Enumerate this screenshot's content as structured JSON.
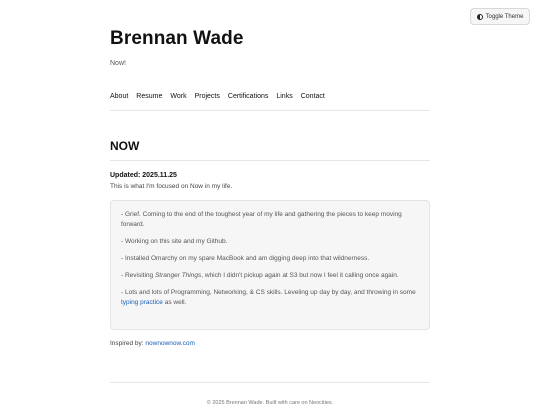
{
  "theme_toggle": {
    "label": "Toggle Theme",
    "icon": "half-moon-icon"
  },
  "header": {
    "name": "Brennan Wade",
    "tagline": "Now!"
  },
  "nav": [
    "About",
    "Resume",
    "Work",
    "Projects",
    "Certifications",
    "Links",
    "Contact"
  ],
  "now": {
    "title": "NOW",
    "updated": "Updated: 2025.11.25",
    "intro": "This is what I'm focused on Now in my life.",
    "items": [
      {
        "text": "- Grief. Coming to the end of the toughest year of my life and gathering the pieces to keep moving forward."
      },
      {
        "text": "- Working on this site and my Github."
      },
      {
        "text": "- Installed Omarchy on my spare MacBook and am digging deep into that wildnerness."
      },
      {
        "before": "- Revisiting ",
        "italic": "Stranger Things",
        "after": ", which I didn't pickup again at S3 but now I feel it calling once again."
      },
      {
        "before": "- Lots and lots of Programming, Networking, & CS skills. Leveling up day by day, and throwing in some ",
        "link": "typing practice",
        "after": " as well."
      }
    ]
  },
  "inspired": {
    "label": "Inspired by: ",
    "link": "nownownow.com"
  },
  "footer": {
    "text": "© 2025 Brennan Wade. Built with care on Neocities."
  },
  "colors": {
    "link": "#1a5fb4",
    "box_bg": "#f6f6f6",
    "text": "#222222"
  }
}
